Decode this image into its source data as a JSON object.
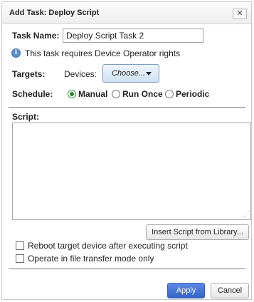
{
  "dialog": {
    "title": "Add Task: Deploy Script",
    "close_glyph": "✕"
  },
  "task_name": {
    "label": "Task Name:",
    "value": "Deploy Script Task 2"
  },
  "info": {
    "icon": "info-icon",
    "icon_glyph": "i",
    "text": "This task requires Device Operator rights"
  },
  "targets": {
    "label": "Targets:",
    "devices_label": "Devices:",
    "choose_label": "Choose..."
  },
  "schedule": {
    "label": "Schedule:",
    "options": [
      "Manual",
      "Run Once",
      "Periodic"
    ],
    "selected": "Manual"
  },
  "script": {
    "label": "Script:",
    "value": "",
    "insert_button": "Insert Script from Library..."
  },
  "options": {
    "reboot": {
      "label": "Reboot target device after executing script",
      "checked": false
    },
    "file_transfer": {
      "label": "Operate in file transfer mode only",
      "checked": false
    }
  },
  "footer": {
    "apply_label": "Apply",
    "cancel_label": "Cancel"
  },
  "colors": {
    "primary_button": "#3563c8",
    "selected_radio": "#2a8a2a",
    "choose_button": "#cfe1f3"
  }
}
